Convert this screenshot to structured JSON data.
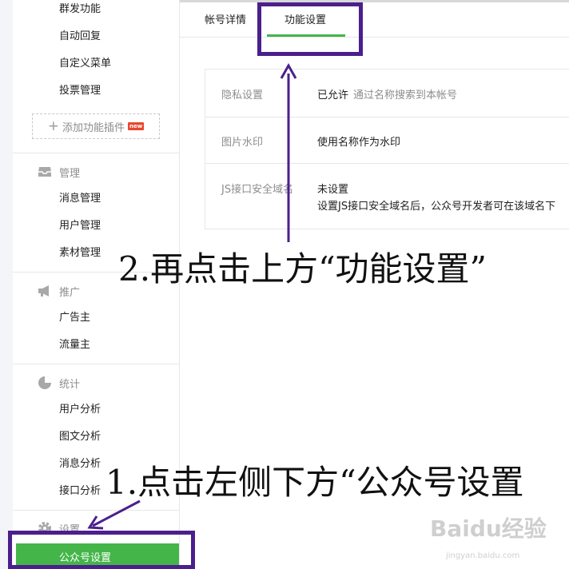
{
  "sidebar": {
    "top_items": [
      "群发功能",
      "自动回复",
      "自定义菜单",
      "投票管理"
    ],
    "add_plugin_label": "添加功能插件",
    "new_badge": "new",
    "sections": [
      {
        "title": "管理",
        "icon": "inbox-icon",
        "items": [
          "消息管理",
          "用户管理",
          "素材管理"
        ]
      },
      {
        "title": "推广",
        "icon": "megaphone-icon",
        "items": [
          "广告主",
          "流量主"
        ]
      },
      {
        "title": "统计",
        "icon": "pie-chart-icon",
        "items": [
          "用户分析",
          "图文分析",
          "消息分析",
          "接口分析"
        ]
      },
      {
        "title": "设置",
        "icon": "gear-icon",
        "items": [
          "公众号设置"
        ]
      }
    ]
  },
  "tabs": [
    {
      "label": "帐号详情",
      "active": false
    },
    {
      "label": "功能设置",
      "active": true
    }
  ],
  "settings": [
    {
      "label": "隐私设置",
      "value": "已允许",
      "desc": "通过名称搜索到本帐号"
    },
    {
      "label": "图片水印",
      "value": "使用名称作为水印"
    },
    {
      "label": "JS接口安全域名",
      "value": "未设置",
      "desc": "设置JS接口安全域名后，公众号开发者可在该域名下"
    }
  ],
  "annotations": {
    "step2": "2.再点击上方“功能设置”",
    "step1": "1.点击左侧下方“公众号设置"
  },
  "watermark": {
    "text": "Baidu经验",
    "sub": "jingyan.baidu.com"
  },
  "colors": {
    "accent": "#44b549",
    "highlight": "#4b1f8c",
    "badge": "#e8472f"
  }
}
